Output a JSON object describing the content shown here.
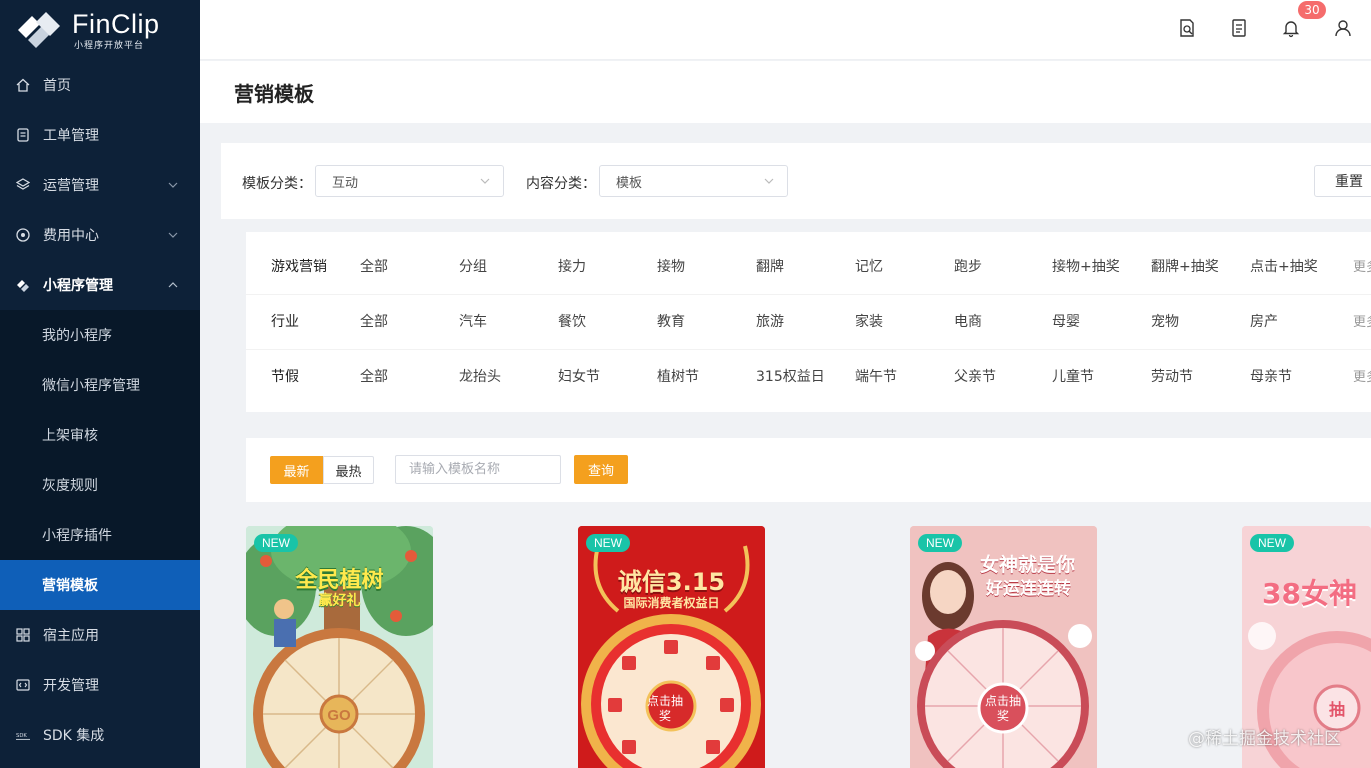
{
  "app": {
    "logo_name": "FinClip",
    "logo_sub": "小程序开放平台"
  },
  "sidebar": {
    "items": [
      {
        "label": "首页"
      },
      {
        "label": "工单管理"
      },
      {
        "label": "运营管理"
      },
      {
        "label": "费用中心"
      },
      {
        "label": "小程序管理"
      },
      {
        "label": "宿主应用"
      },
      {
        "label": "开发管理"
      },
      {
        "label": "SDK 集成"
      }
    ],
    "sub_items": [
      {
        "label": "我的小程序"
      },
      {
        "label": "微信小程序管理"
      },
      {
        "label": "上架审核"
      },
      {
        "label": "灰度规则"
      },
      {
        "label": "小程序插件"
      },
      {
        "label": "营销模板"
      }
    ]
  },
  "header": {
    "notification_count": "30"
  },
  "page": {
    "title": "营销模板"
  },
  "filters": {
    "template_category_label": "模板分类：",
    "template_category_value": "互动",
    "content_category_label": "内容分类：",
    "content_category_value": "模板",
    "reset_label": "重置"
  },
  "categories": {
    "more_label": "更多",
    "rows": [
      {
        "head": "游戏营销",
        "items": [
          "全部",
          "分组",
          "接力",
          "接物",
          "翻牌",
          "记忆",
          "跑步",
          "接物+抽奖",
          "翻牌+抽奖",
          "点击+抽奖"
        ]
      },
      {
        "head": "行业",
        "items": [
          "全部",
          "汽车",
          "餐饮",
          "教育",
          "旅游",
          "家装",
          "电商",
          "母婴",
          "宠物",
          "房产"
        ]
      },
      {
        "head": "节假",
        "items": [
          "全部",
          "龙抬头",
          "妇女节",
          "植树节",
          "315权益日",
          "端午节",
          "父亲节",
          "儿童节",
          "劳动节",
          "母亲节"
        ]
      }
    ]
  },
  "sort": {
    "newest": "最新",
    "hottest": "最热",
    "search_placeholder": "请输入模板名称",
    "query": "查询"
  },
  "templates": [
    {
      "badge": "NEW",
      "title": "全民植树",
      "subtitle": "赢好礼",
      "wheel_center": "GO"
    },
    {
      "badge": "NEW",
      "title": "诚信3.15",
      "subtitle": "国际消费者权益日",
      "wheel_center": "点击抽奖"
    },
    {
      "badge": "NEW",
      "title": "女神就是你",
      "subtitle": "好运连连转",
      "wheel_center": "点击抽奖"
    },
    {
      "badge": "NEW",
      "title": "38女神",
      "subtitle": "",
      "wheel_center": "抽"
    }
  ],
  "watermark": "@稀土掘金技术社区",
  "colors": {
    "sidebar_bg": "#0d2138",
    "active_menu": "#0f5fb8",
    "accent": "#f4a01e",
    "badge": "#f56c6c",
    "new_tag": "#19c4a8"
  }
}
